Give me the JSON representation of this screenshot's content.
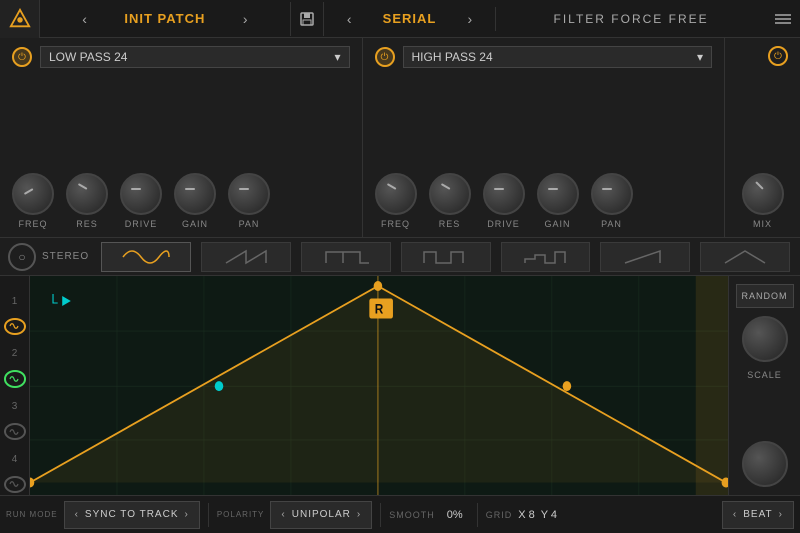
{
  "topbar": {
    "patch_prev": "‹",
    "patch_next": "›",
    "patch_name": "INIT PATCH",
    "save_icon": "💾",
    "serial_prev": "‹",
    "serial_next": "›",
    "serial_name": "SERIAL",
    "filter_label": "FILTER FORCE FREE",
    "menu_icon": "☰"
  },
  "filter1": {
    "type": "LOW PASS 24",
    "knobs": [
      {
        "label": "FREQ"
      },
      {
        "label": "RES"
      },
      {
        "label": "DRIVE"
      },
      {
        "label": "GAIN"
      },
      {
        "label": "PAN"
      }
    ]
  },
  "filter2": {
    "type": "HIGH PASS 24",
    "knobs": [
      {
        "label": "FREQ"
      },
      {
        "label": "RES"
      },
      {
        "label": "DRIVE"
      },
      {
        "label": "GAIN"
      },
      {
        "label": "PAN"
      },
      {
        "label": "MIX"
      }
    ]
  },
  "lfo_row": {
    "stereo": "STEREO"
  },
  "left_sidebar": {
    "numbers": [
      "1",
      "2",
      "3",
      "4"
    ]
  },
  "right_sidebar": {
    "random_label": "RANDOM",
    "scale_label": "SCALE"
  },
  "bottom_bar": {
    "sync_label": "SYNC TO TRACK",
    "polarity_label": "POLARITY",
    "polarity_value": "UNIPOLAR",
    "smooth_label": "SMOOTH",
    "smooth_value": "0%",
    "grid_label": "GRID",
    "grid_x": "X 8",
    "grid_y": "Y 4",
    "beat_label": "BEAT",
    "run_mode_label": "RUN MODE"
  }
}
